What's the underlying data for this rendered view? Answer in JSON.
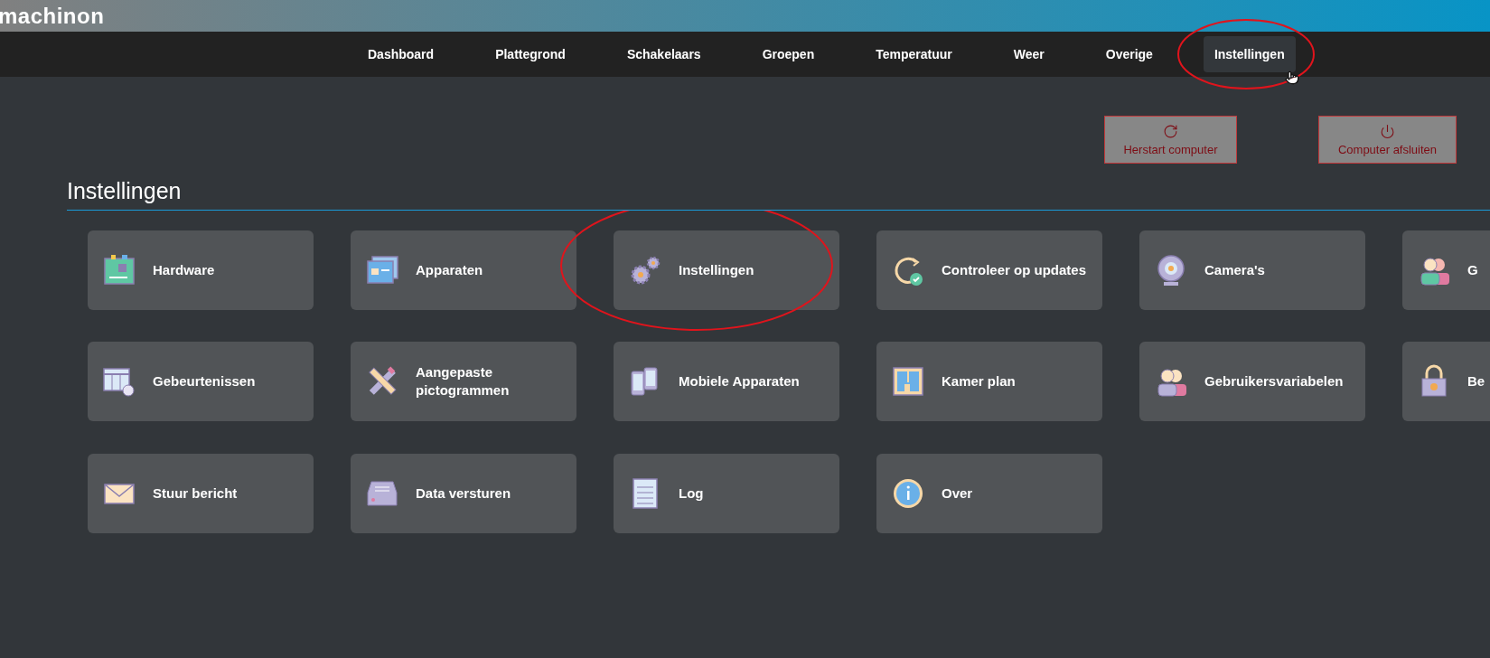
{
  "logo": "machinon",
  "nav": [
    {
      "label": "Dashboard",
      "selected": false,
      "circled": false,
      "cursor": false
    },
    {
      "label": "Plattegrond",
      "selected": false,
      "circled": false,
      "cursor": false
    },
    {
      "label": "Schakelaars",
      "selected": false,
      "circled": false,
      "cursor": false
    },
    {
      "label": "Groepen",
      "selected": false,
      "circled": false,
      "cursor": false
    },
    {
      "label": "Temperatuur",
      "selected": false,
      "circled": false,
      "cursor": false
    },
    {
      "label": "Weer",
      "selected": false,
      "circled": false,
      "cursor": false
    },
    {
      "label": "Overige",
      "selected": false,
      "circled": false,
      "cursor": false
    },
    {
      "label": "Instellingen",
      "selected": true,
      "circled": true,
      "cursor": true
    }
  ],
  "actions": [
    {
      "label": "Herstart computer",
      "kind": "restart"
    },
    {
      "label": "Computer afsluiten",
      "kind": "power"
    }
  ],
  "heading": "Instellingen",
  "tiles": [
    {
      "label": "Hardware",
      "circled": false
    },
    {
      "label": "Apparaten",
      "circled": false
    },
    {
      "label": "Instellingen",
      "circled": true
    },
    {
      "label": "Controleer op updates",
      "circled": false
    },
    {
      "label": "Camera's",
      "circled": false
    },
    {
      "label": "G",
      "circled": false
    },
    {
      "label": "Gebeurtenissen",
      "circled": false
    },
    {
      "label": "Aangepaste pictogrammen",
      "circled": false
    },
    {
      "label": "Mobiele Apparaten",
      "circled": false
    },
    {
      "label": "Kamer plan",
      "circled": false
    },
    {
      "label": "Gebruikersvariabelen",
      "circled": false
    },
    {
      "label": "Be",
      "circled": false
    },
    {
      "label": "Stuur bericht",
      "circled": false
    },
    {
      "label": "Data versturen",
      "circled": false
    },
    {
      "label": "Log",
      "circled": false
    },
    {
      "label": "Over",
      "circled": false
    }
  ]
}
